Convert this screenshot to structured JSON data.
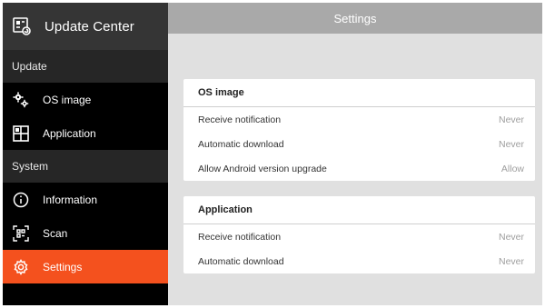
{
  "sidebar": {
    "app_title": "Update Center",
    "app_icon": "update-center-icon",
    "sections": [
      {
        "label": "Update",
        "items": [
          {
            "label": "OS image",
            "icon": "gears-icon"
          },
          {
            "label": "Application",
            "icon": "app-grid-icon"
          }
        ]
      },
      {
        "label": "System",
        "items": [
          {
            "label": "Information",
            "icon": "info-icon"
          },
          {
            "label": "Scan",
            "icon": "scan-icon"
          },
          {
            "label": "Settings",
            "icon": "gear-icon",
            "active": true
          }
        ]
      }
    ]
  },
  "topbar": {
    "title": "Settings"
  },
  "cards": [
    {
      "title": "OS image",
      "rows": [
        {
          "label": "Receive notification",
          "value": "Never"
        },
        {
          "label": "Automatic download",
          "value": "Never"
        },
        {
          "label": "Allow Android version upgrade",
          "value": "Allow"
        }
      ]
    },
    {
      "title": "Application",
      "rows": [
        {
          "label": "Receive notification",
          "value": "Never"
        },
        {
          "label": "Automatic download",
          "value": "Never"
        }
      ]
    }
  ],
  "colors": {
    "accent": "#f4511e",
    "sidebar_bg": "#000000",
    "sidebar_header": "#353535",
    "section_bg": "#262626",
    "topbar": "#a9a9a9",
    "content_bg": "#e0e0e0"
  }
}
